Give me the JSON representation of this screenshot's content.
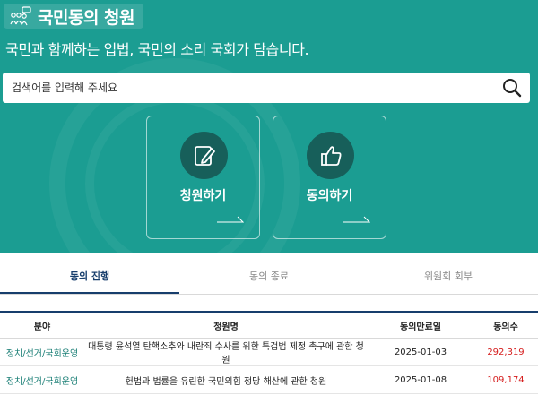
{
  "header": {
    "brand_title": "국민동의 청원",
    "brand_icon": "people-speech-icon",
    "subtitle": "국민과 함께하는 입법, 국민의 소리 국회가 담습니다."
  },
  "search": {
    "placeholder": "검색어를 입력해 주세요",
    "icon": "search-icon"
  },
  "actions": [
    {
      "label": "청원하기",
      "icon": "edit-pen-icon"
    },
    {
      "label": "동의하기",
      "icon": "thumbs-up-icon"
    }
  ],
  "tabs": [
    {
      "label": "동의 진행",
      "active": true
    },
    {
      "label": "동의 종료",
      "active": false
    },
    {
      "label": "위원회 회부",
      "active": false
    }
  ],
  "table": {
    "headers": [
      "분야",
      "청원명",
      "동의만료일",
      "동의수"
    ],
    "rows": [
      [
        "정치/선거/국회운영",
        "대통령 윤석열 탄핵소추와 내란죄 수사를 위한 특검법 제정 촉구에 관한 청원",
        "2025-01-03",
        "292,319"
      ],
      [
        "정치/선거/국회운영",
        "헌법과 법률을 유린한 국민의힘 정당 해산에 관한 청원",
        "2025-01-08",
        "109,174"
      ]
    ]
  },
  "colors": {
    "hero_bg": "#1b9d92",
    "icon_circle": "#175f5a",
    "tab_active": "#173e6c",
    "category_text": "#1b7f76",
    "count_text": "#d51c1c"
  }
}
